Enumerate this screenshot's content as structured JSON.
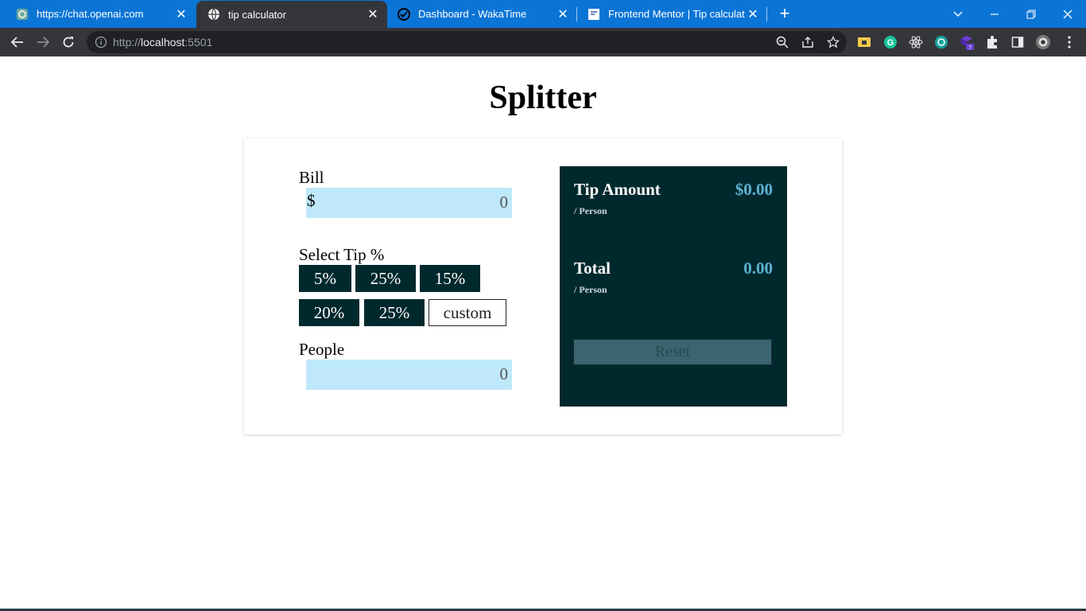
{
  "browser": {
    "tabs": [
      {
        "title": "https://chat.openai.com",
        "icon": "openai-icon",
        "active": false
      },
      {
        "title": "tip calculator",
        "icon": "globe-icon",
        "active": true
      },
      {
        "title": "Dashboard - WakaTime",
        "icon": "wakatime-icon",
        "active": false
      },
      {
        "title": "Frontend Mentor | Tip calculator",
        "icon": "frontend-mentor-icon",
        "active": false
      }
    ],
    "new_tab": "+",
    "url_prefix": "http://",
    "url_host": "localhost",
    "url_port": ":5501"
  },
  "app": {
    "title": "Splitter",
    "bill": {
      "label": "Bill",
      "currency": "$",
      "value": "0"
    },
    "tip": {
      "label": "Select Tip %",
      "options": [
        "5%",
        "25%",
        "15%",
        "20%",
        "25%"
      ],
      "custom": "custom"
    },
    "people": {
      "label": "People",
      "value": "0"
    },
    "result": {
      "tip_label": "Tip Amount",
      "tip_sub": "/ Person",
      "tip_value": "$0.00",
      "total_label": "Total",
      "total_sub": "/ Person",
      "total_value": "0.00",
      "reset": "Reset"
    }
  },
  "colors": {
    "tab_bar": "#0b75d6",
    "toolbar": "#35363a",
    "panel": "#00292e",
    "input_bg": "#bfe9fb",
    "accent": "#5eb1d1"
  }
}
